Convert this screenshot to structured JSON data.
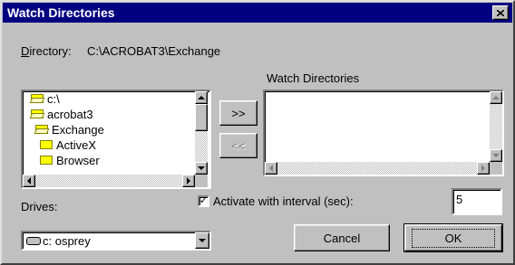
{
  "window": {
    "title": "Watch Directories"
  },
  "directory": {
    "label_first": "D",
    "label_rest": "irectory:",
    "path": "C:\\ACROBAT3\\Exchange"
  },
  "tree": {
    "items": [
      {
        "label": "c:\\",
        "icon": "open-folder-icon"
      },
      {
        "label": "acrobat3",
        "icon": "open-folder-icon"
      },
      {
        "label": "Exchange",
        "icon": "open-folder-icon"
      },
      {
        "label": "ActiveX",
        "icon": "folder-icon"
      },
      {
        "label": "Browser",
        "icon": "folder-icon"
      }
    ]
  },
  "buttons": {
    "add": ">>",
    "remove": "<<",
    "cancel": "Cancel",
    "ok": "OK"
  },
  "watch": {
    "label": "Watch Directories",
    "items": []
  },
  "drives": {
    "label": "Drives:",
    "selected": "c: osprey",
    "icon": "drive-icon"
  },
  "interval": {
    "label": "Activate with interval (sec):",
    "checked": true,
    "value": "5"
  },
  "colors": {
    "title_bar": "#000080",
    "face": "#c0c0c0"
  }
}
